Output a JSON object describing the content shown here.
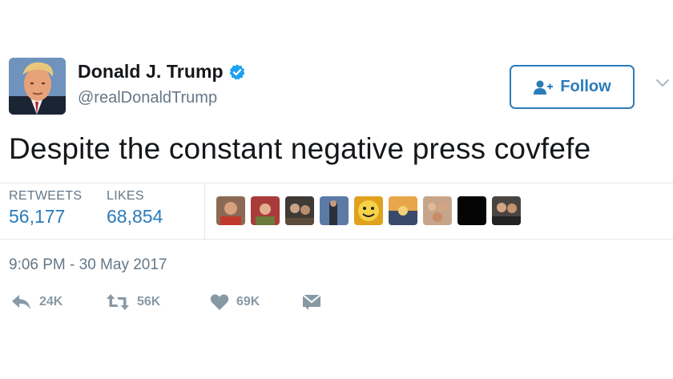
{
  "user": {
    "display_name": "Donald J. Trump",
    "handle": "@realDonaldTrump",
    "verified": true
  },
  "follow_button": {
    "label": "Follow"
  },
  "tweet": {
    "text": "Despite the constant negative press covfefe",
    "timestamp": "9:06 PM - 30 May 2017"
  },
  "stats": {
    "retweets_label": "RETWEETS",
    "retweets_value": "56,177",
    "likes_label": "LIKES",
    "likes_value": "68,854"
  },
  "actions": {
    "reply_count": "24K",
    "retweet_count": "56K",
    "like_count": "69K"
  },
  "colors": {
    "accent": "#2b7bb9",
    "verified": "#1da1f2",
    "secondary_text": "#657786",
    "icon_gray": "#8899a6",
    "divider": "#e1e8ed"
  },
  "icons": {
    "verified": "verified-badge-icon",
    "follow": "follow-user-icon",
    "caret": "chevron-down-icon",
    "reply": "reply-icon",
    "retweet": "retweet-icon",
    "like": "heart-icon",
    "message": "direct-message-icon"
  }
}
